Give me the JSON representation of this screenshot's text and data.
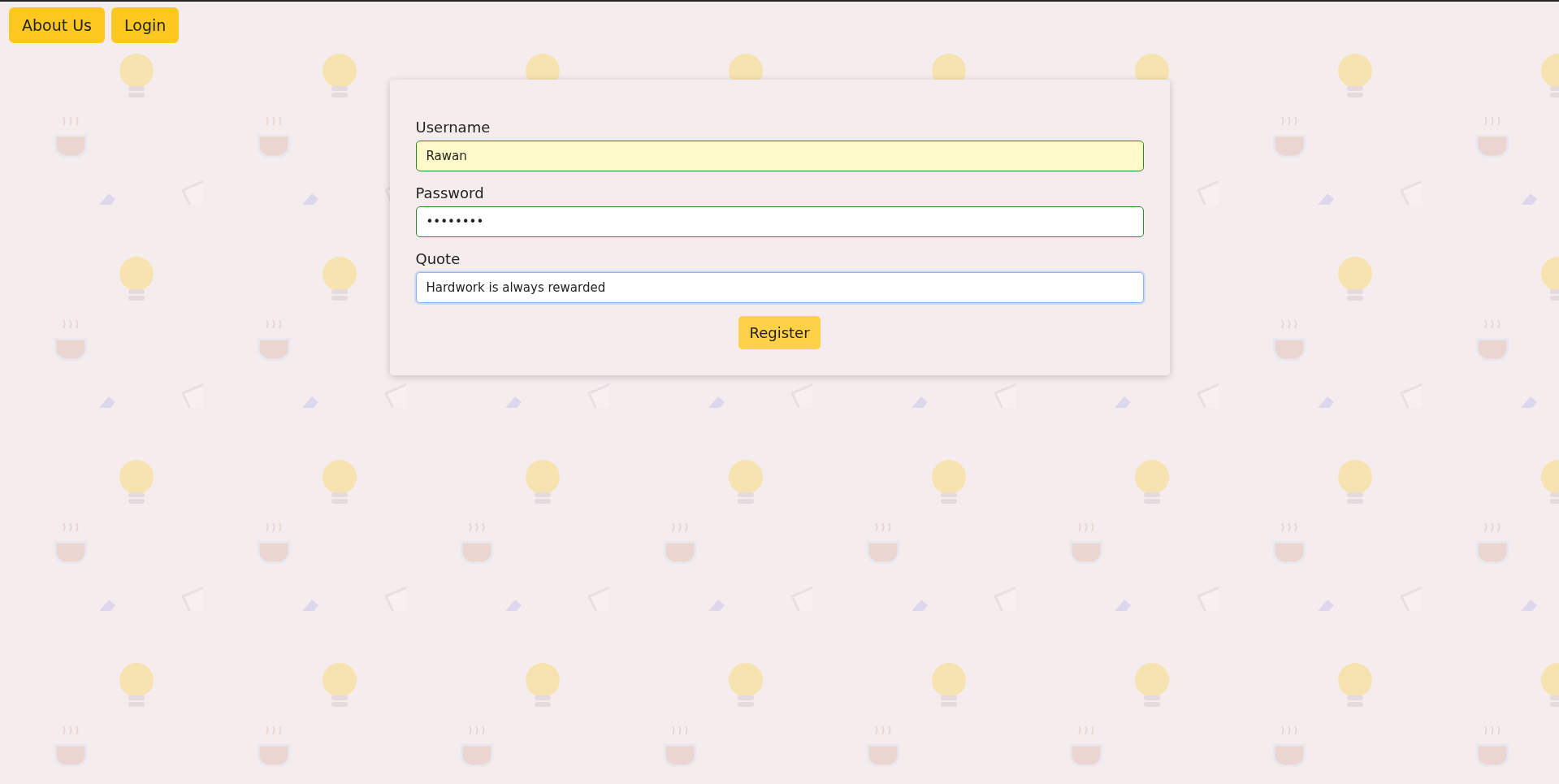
{
  "nav": {
    "buttons": [
      "About Us",
      "Login"
    ]
  },
  "form": {
    "fields": [
      {
        "label": "Username",
        "value": "Rawan",
        "autofilled": true,
        "valid": true,
        "focused": false
      },
      {
        "label": "Password",
        "value": "••••••••",
        "autofilled": false,
        "valid": true,
        "focused": false
      },
      {
        "label": "Quote",
        "value": "Hardwork is always rewarded",
        "autofilled": false,
        "valid": false,
        "focused": true
      }
    ],
    "submit": "Register"
  }
}
